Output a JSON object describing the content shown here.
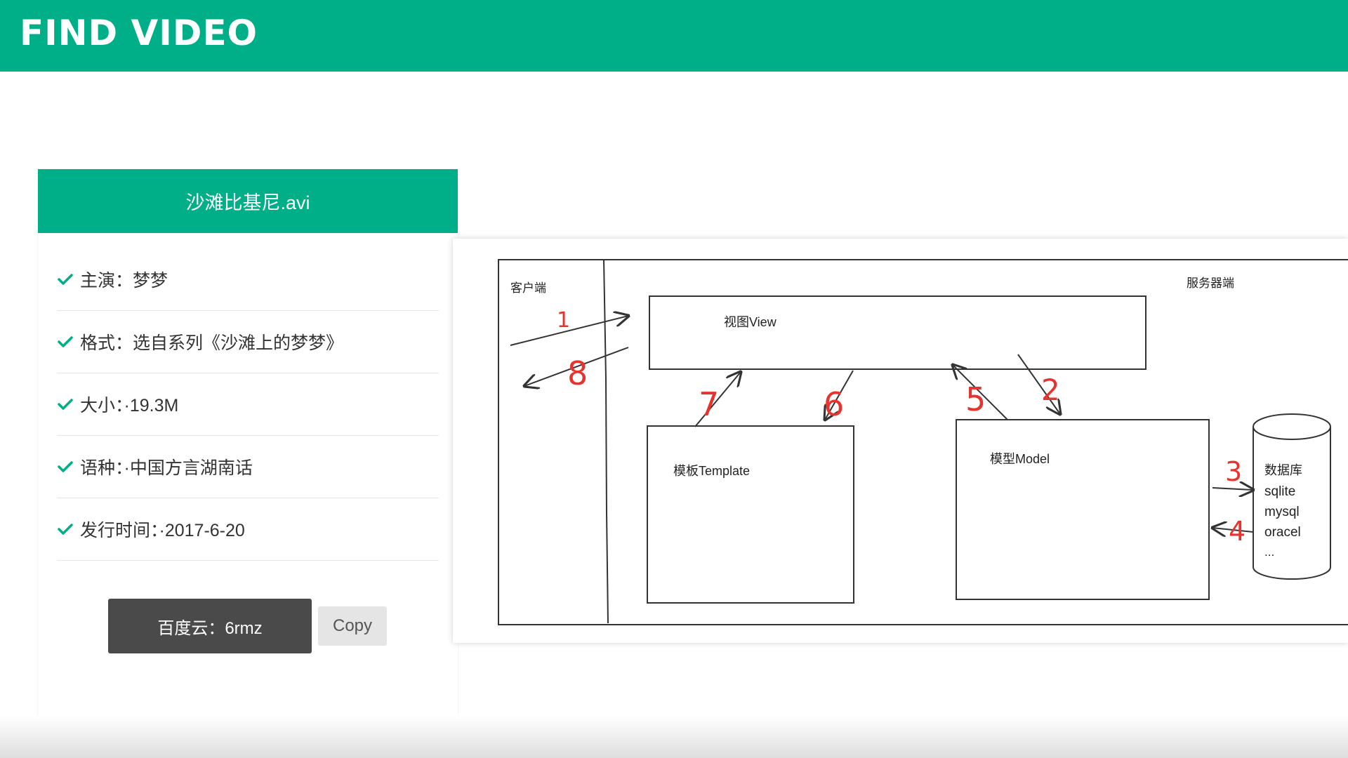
{
  "header": {
    "brand": "FIND VIDEO"
  },
  "video": {
    "title": "沙滩比基尼.avi",
    "details": [
      "主演：梦梦",
      "格式：选自系列《沙滩上的梦梦》",
      "大小：·19.3M",
      "语种：·中国方言湖南话",
      "发行时间：·2017-6-20"
    ],
    "code_button": "百度云：6rmz",
    "copy_button": "Copy"
  },
  "diagram": {
    "client_label": "客户端",
    "server_label": "服务器端",
    "view_label": "视图View",
    "template_label": "模板Template",
    "model_label": "模型Model",
    "database_lines": [
      "数据库",
      "sqlite",
      "mysql",
      "oracel",
      "..."
    ],
    "step_numbers": [
      "1",
      "8",
      "7",
      "6",
      "5",
      "2",
      "3",
      "4"
    ]
  },
  "colors": {
    "brand_green": "#00ae88",
    "dark_button": "#4a4a4a",
    "light_button": "#e5e5e5",
    "annotation_red": "#e8322d"
  },
  "icons": {
    "detail_marker": "check-icon"
  }
}
